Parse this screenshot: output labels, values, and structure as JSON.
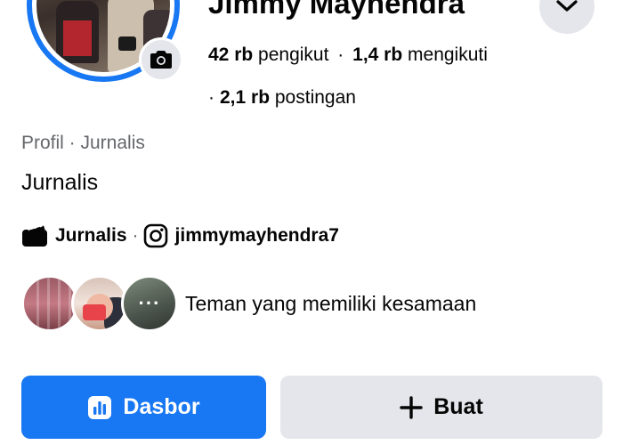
{
  "profile": {
    "name": "Jimmy Mayhendra",
    "followers_count": "42 rb",
    "followers_label": "pengikut",
    "following_count": "1,4 rb",
    "following_label": "mengikuti",
    "posts_count": "2,1 rb",
    "posts_label": "postingan",
    "separator": "·",
    "category_line": "Profil · Jurnalis",
    "bio": "Jurnalis"
  },
  "links": {
    "work_label": "Jurnalis",
    "separator": "·",
    "instagram_handle": "jimmymayhendra7"
  },
  "mutual": {
    "label": "Teman yang memiliki kesamaan",
    "more_dots": "···"
  },
  "actions": {
    "dashboard_label": "Dasbor",
    "create_label": "Buat"
  },
  "icons": {
    "camera": "camera-icon",
    "chevron": "chevron-down-icon",
    "clapperboard": "clapperboard-icon",
    "instagram": "instagram-icon",
    "dashboard": "bar-chart-icon",
    "plus": "plus-icon"
  },
  "colors": {
    "accent": "#1877f2",
    "button_gray": "#e4e6eb",
    "secondary_text": "#65676b",
    "text": "#050505"
  }
}
